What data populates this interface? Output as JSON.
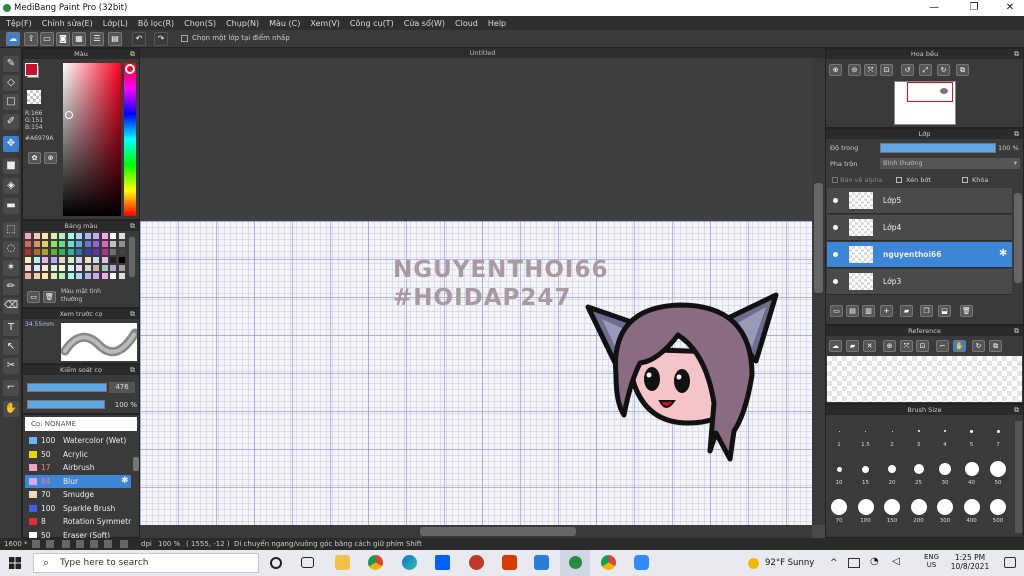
{
  "window": {
    "title": "MediBang Paint Pro (32bit)"
  },
  "menu": [
    "Tệp(F)",
    "Chỉnh sửa(E)",
    "Lớp(L)",
    "Bộ lọc(R)",
    "Chọn(S)",
    "Chụp(N)",
    "Màu (C)",
    "Xem(V)",
    "Công cụ(T)",
    "Cửa sổ(W)",
    "Cloud",
    "Help"
  ],
  "toolbar": {
    "checkbox_label": "Chọn một lớp tại điểm nhấp"
  },
  "color_panel": {
    "title": "Màu",
    "r": "R:166",
    "g": "G:151",
    "b": "B:154",
    "hex": "#A6979A"
  },
  "palette_panel": {
    "title": "Bảng màu",
    "name": "Màu mặt tinh thường"
  },
  "preview_panel": {
    "title": "Xem trước cọ",
    "size": "34.55mm"
  },
  "brush_control": {
    "title": "Kiểm soát cọ",
    "size": "476",
    "opacity": "100 %"
  },
  "brush_list": {
    "header": "Cọ: NONAME",
    "items": [
      {
        "size": "100",
        "name": "Watercolor (Wet)",
        "color": "#6ab6f0"
      },
      {
        "size": "50",
        "name": "Acrylic",
        "color": "#f0d020"
      },
      {
        "size": "17",
        "name": "Airbrush",
        "color": "#f0a0c0"
      },
      {
        "size": "84",
        "name": "Blur",
        "color": "#d8a8e8"
      },
      {
        "size": "70",
        "name": "Smudge",
        "color": "#f0d8b0"
      },
      {
        "size": "100",
        "name": "Sparkle Brush",
        "color": "#4060f0"
      },
      {
        "size": "8",
        "name": "Rotation Symmetr",
        "color": "#e03030"
      },
      {
        "size": "50",
        "name": "Eraser (Soft)",
        "color": "#ffffff"
      }
    ]
  },
  "canvas": {
    "tab": "Untitled",
    "watermark_1": "NGUYENTHOI66",
    "watermark_2": "#HOIDAP247"
  },
  "navigator": {
    "title": "Hoa bếu"
  },
  "layer_panel": {
    "title": "Lớp",
    "opacity_label": "Độ trong",
    "opacity_value": "100 %",
    "opacity_fraction": 1.0,
    "blend_label": "Pha trộn",
    "blend_value": "Bình thường",
    "protect_alpha": "Bảo vệ alpha",
    "clipping": "Xén bớt",
    "lock": "Khóa",
    "layers": [
      "Lớp5",
      "Lớp4",
      "nguyenthoi66",
      "Lớp3"
    ],
    "selected": 2
  },
  "reference": {
    "title": "Reference"
  },
  "brush_size": {
    "title": "Brush Size",
    "row1": [
      "1",
      "1.5",
      "2",
      "3",
      "4",
      "5",
      "7"
    ],
    "row2": [
      "10",
      "15",
      "20",
      "25",
      "30",
      "40",
      "50"
    ],
    "row3": [
      "70",
      "100",
      "150",
      "200",
      "300",
      "400",
      "500"
    ]
  },
  "status": {
    "zoom": "1600 *",
    "dpi": "dpi",
    "scale": "100 %",
    "coords": "( 1555, -12 )",
    "hint": "Di chuyển ngang/vuông góc bằng cách giữ phím Shift"
  },
  "taskbar": {
    "search": "Type here to search",
    "weather": "92°F  Sunny",
    "lang1": "ENG",
    "lang2": "US",
    "time": "1:25 PM",
    "date": "10/8/2021"
  }
}
